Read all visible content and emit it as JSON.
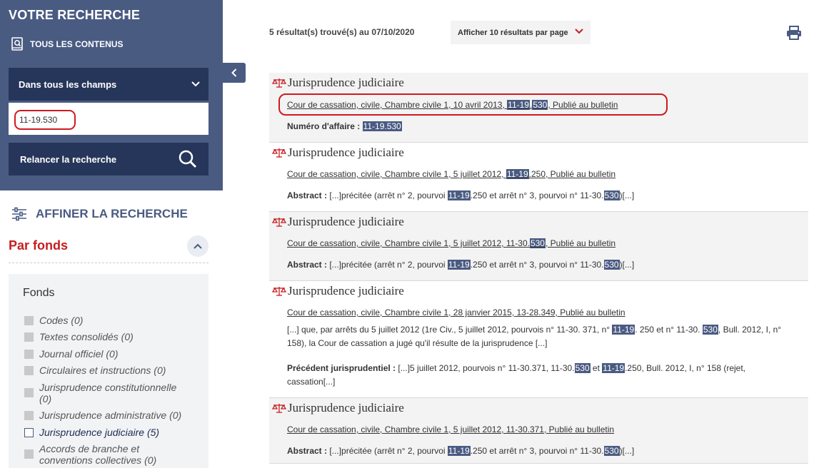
{
  "sidebar": {
    "title": "VOTRE RECHERCHE",
    "all_contents": "TOUS LES CONTENUS",
    "field_select": "Dans tous les champs",
    "search_value": "11-19.530",
    "relaunch": "Relancer la recherche",
    "refine_title": "AFFINER LA RECHERCHE",
    "par_fonds": "Par fonds",
    "fonds_label": "Fonds",
    "fonds": [
      {
        "label": "Codes",
        "count": "(0)"
      },
      {
        "label": "Textes consolidés",
        "count": "(0)"
      },
      {
        "label": "Journal officiel",
        "count": "(0)"
      },
      {
        "label": "Circulaires et instructions",
        "count": "(0)"
      },
      {
        "label": "Jurisprudence constitutionnelle",
        "count": "(0)"
      },
      {
        "label": "Jurisprudence administrative",
        "count": "(0)"
      },
      {
        "label": "Jurisprudence judiciaire",
        "count": "(5)"
      },
      {
        "label": "Accords de branche et conventions collectives",
        "count": "(0)"
      }
    ]
  },
  "main": {
    "result_count": "5 résultat(s) trouvé(s) au 07/10/2020",
    "per_page": "Afficher 10 résultats par page",
    "results": [
      {
        "type": "Jurisprudence judiciaire",
        "title": [
          "Cour de cassation, civile, Chambre civile 1, 10 avril 2013, ",
          "11-19",
          ".",
          "530",
          ", Publié au bulletin"
        ],
        "label": "Numéro d'affaire :",
        "text": [
          "11-19.530"
        ]
      },
      {
        "type": "Jurisprudence judiciaire",
        "title": [
          "Cour de cassation, civile, Chambre civile 1, 5 juillet 2012, ",
          "11-19",
          ".250, Publié au bulletin"
        ],
        "label": "Abstract :",
        "text": [
          " [...]précitée (arrêt n° 2, pourvoi ",
          "11-19",
          ".250 et arrêt n° 3, pourvoi n° 11-30.",
          "530",
          ")[...]"
        ]
      },
      {
        "type": "Jurisprudence judiciaire",
        "title": [
          "Cour de cassation, civile, Chambre civile 1, 5 juillet 2012, 11-30.",
          "530",
          ", Publié au bulletin"
        ],
        "label": "Abstract :",
        "text": [
          " [...]précitée (arrêt n° 2, pourvoi ",
          "11-19",
          ".250 et arrêt n° 3, pourvoi n° 11-30.",
          "530",
          ")[...]"
        ]
      },
      {
        "type": "Jurisprudence judiciaire",
        "title": [
          "Cour de cassation, civile, Chambre civile 1, 28 janvier 2015, 13-28.349, Publié au bulletin"
        ],
        "excerpt": [
          "[...] que, par arrêts du 5 juillet 2012 (1re Civ., 5 juillet 2012, pourvois n° 11-30. 371, n° ",
          "11-19",
          ". 250 et n° 11-30. ",
          "530",
          ", Bull. 2012, I, n° 158), la Cour de cassation a jugé qu'il résulte de la jurisprudence [...]"
        ],
        "label": "Précédent jurisprudentiel :",
        "text": [
          " [...]5 juillet 2012, pourvois n° 11-30.371, 11-30.",
          "530",
          " et ",
          "11-19",
          ".250, Bull. 2012, I, n° 158 (rejet, cassation[...]"
        ]
      },
      {
        "type": "Jurisprudence judiciaire",
        "title": [
          "Cour de cassation, civile, Chambre civile 1, 5 juillet 2012, 11-30.371, Publié au bulletin"
        ],
        "label": "Abstract :",
        "text": [
          " [...]précitée (arrêt n° 2, pourvoi ",
          "11-19",
          ".250 et arrêt n° 3, pourvoi n° 11-30.",
          "530",
          ")[...]"
        ]
      }
    ]
  },
  "colors": {
    "sidebar": "#4a5b82",
    "dark": "#26365b",
    "accent_red": "#c61d20",
    "highlight": "#4a5b82"
  },
  "icons": [
    "book-search-icon",
    "chevron-down-icon",
    "search-icon",
    "chevron-left-icon",
    "sliders-icon",
    "chevron-up-icon",
    "print-icon",
    "scales-icon"
  ]
}
